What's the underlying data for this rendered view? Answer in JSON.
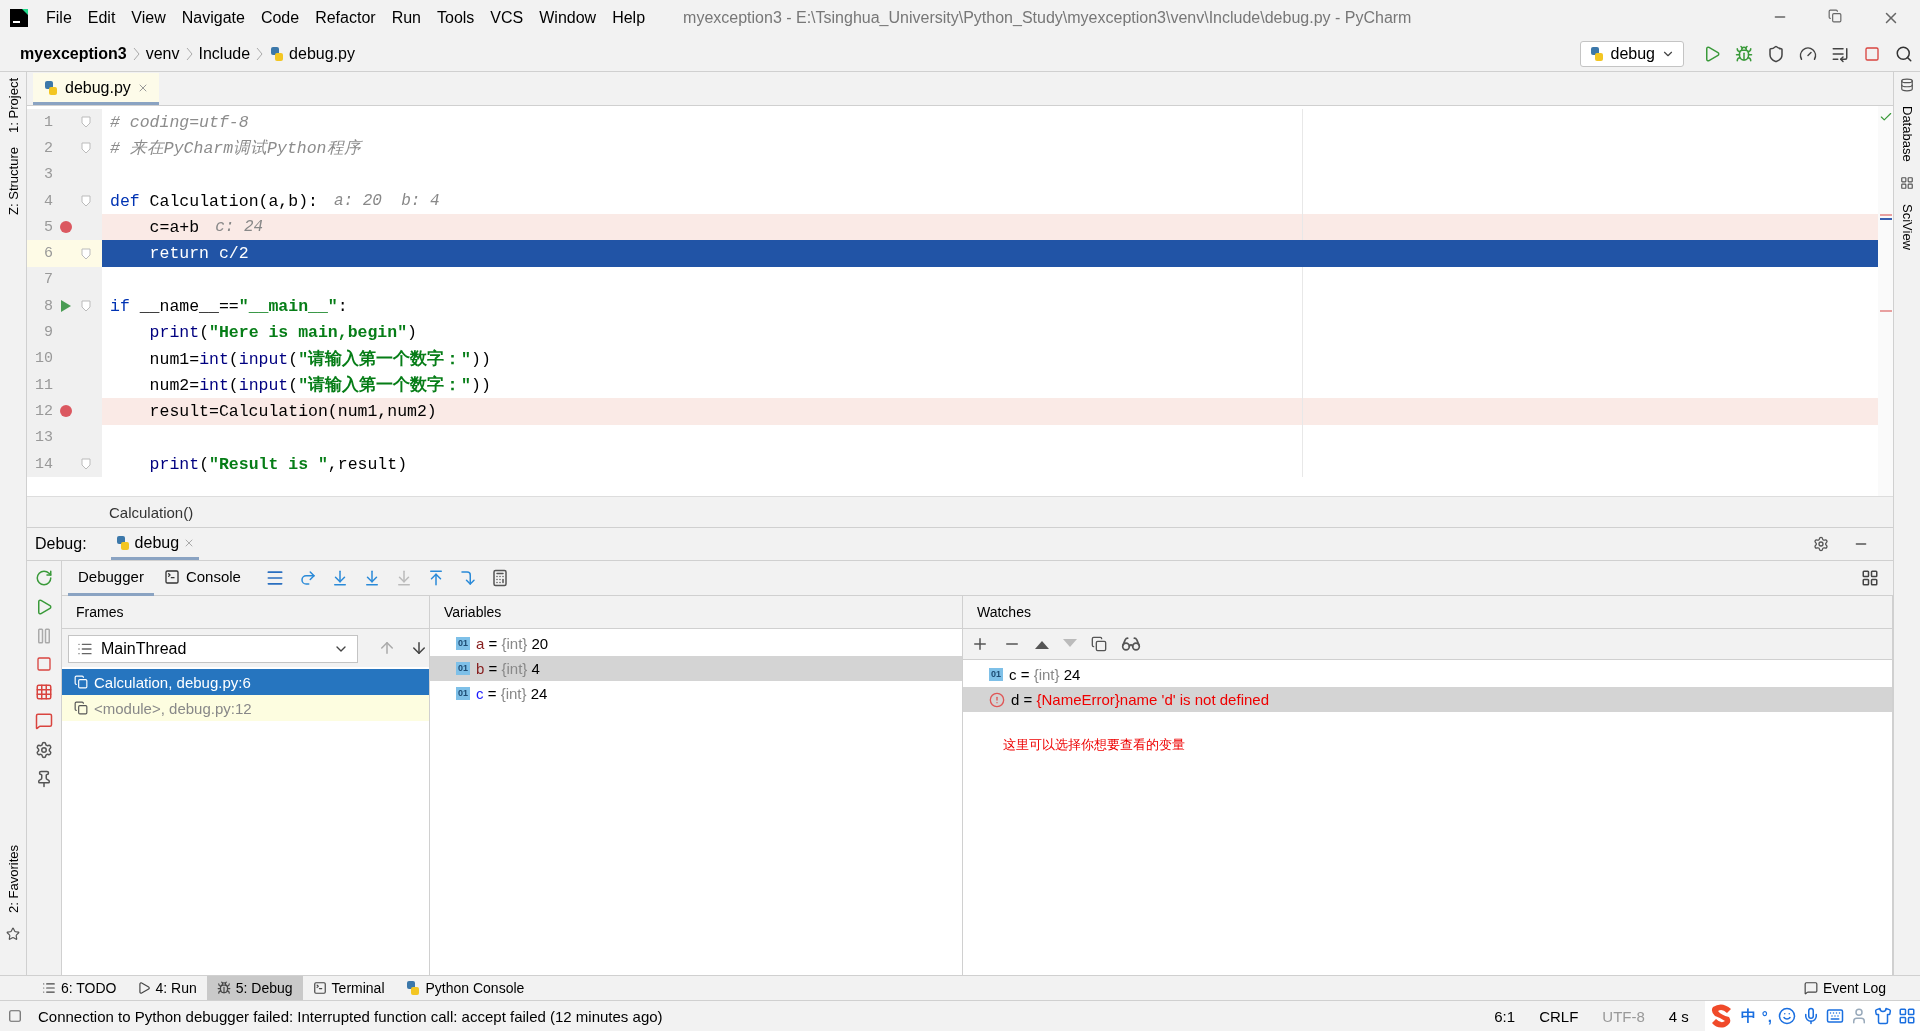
{
  "window": {
    "title": "myexception3 - E:\\Tsinghua_University\\Python_Study\\myexception3\\venv\\Include\\debug.py - PyCharm"
  },
  "menu": [
    "File",
    "Edit",
    "View",
    "Navigate",
    "Code",
    "Refactor",
    "Run",
    "Tools",
    "VCS",
    "Window",
    "Help"
  ],
  "breadcrumbs": [
    {
      "label": "myexception3",
      "kind": "project"
    },
    {
      "label": "venv",
      "kind": "folder"
    },
    {
      "label": "Include",
      "kind": "folder"
    },
    {
      "label": "debug.py",
      "kind": "file"
    }
  ],
  "run_config": {
    "label": "debug"
  },
  "left_strip": {
    "top": [
      "1: Project",
      "Z: Structure"
    ],
    "bottom": [
      "2: Favorites"
    ]
  },
  "right_strip": [
    "Database",
    "SciView"
  ],
  "editor_tabs": [
    {
      "label": "debug.py",
      "selected": true
    }
  ],
  "code": [
    {
      "number": "1",
      "tokens": [
        {
          "kind": "comment",
          "t": "# coding=utf-8"
        }
      ],
      "breakpoint": false,
      "current": false,
      "run_marker": false,
      "fold": true
    },
    {
      "number": "2",
      "tokens": [
        {
          "kind": "comment",
          "t": "# 来在PyCharm调试Python程序"
        }
      ],
      "breakpoint": false,
      "current": false,
      "run_marker": false,
      "fold": true
    },
    {
      "number": "3",
      "breakpoint": false,
      "current": false,
      "run_marker": false,
      "fold": false
    },
    {
      "number": "4",
      "tokens": [
        {
          "kind": "kw",
          "t": "def"
        },
        {
          "kind": "plain",
          "t": " Calculation(a,b):"
        }
      ],
      "hint": "a: 20  b: 4",
      "breakpoint": false,
      "current": false,
      "run_marker": false,
      "fold": true
    },
    {
      "number": "5",
      "tokens": [
        {
          "kind": "plain",
          "t": "    c=a+b"
        }
      ],
      "hint": "c: 24",
      "breakpoint": true,
      "current": false,
      "run_marker": false,
      "fold": false
    },
    {
      "number": "6",
      "tokens": [
        {
          "kind": "plain",
          "t": "    return c/2"
        }
      ],
      "breakpoint": false,
      "current": true,
      "run_marker": false,
      "fold": true
    },
    {
      "number": "7",
      "breakpoint": false,
      "current": false,
      "run_marker": false,
      "fold": false
    },
    {
      "number": "8",
      "tokens": [
        {
          "kind": "kw",
          "t": "if"
        },
        {
          "kind": "plain",
          "t": " __name__=="
        },
        {
          "kind": "str",
          "t": "\"__main__\""
        },
        {
          "kind": "plain",
          "t": ":"
        }
      ],
      "breakpoint": false,
      "current": false,
      "run_marker": true,
      "fold": true
    },
    {
      "number": "9",
      "tokens": [
        {
          "kind": "builtin",
          "t": "    print"
        },
        {
          "kind": "plain",
          "t": "("
        },
        {
          "kind": "str",
          "t": "\"Here is main,begin\""
        },
        {
          "kind": "plain",
          "t": ")"
        }
      ],
      "breakpoint": false,
      "current": false,
      "run_marker": false,
      "fold": false
    },
    {
      "number": "10",
      "tokens": [
        {
          "kind": "plain",
          "t": "    num1="
        },
        {
          "kind": "builtin",
          "t": "int"
        },
        {
          "kind": "plain",
          "t": "("
        },
        {
          "kind": "builtin",
          "t": "input"
        },
        {
          "kind": "plain",
          "t": "("
        },
        {
          "kind": "str",
          "t": "\"请输入第一个数字：\""
        },
        {
          "kind": "plain",
          "t": "))"
        }
      ],
      "breakpoint": false,
      "current": false,
      "run_marker": false,
      "fold": false
    },
    {
      "number": "11",
      "tokens": [
        {
          "kind": "plain",
          "t": "    num2="
        },
        {
          "kind": "builtin",
          "t": "int"
        },
        {
          "kind": "plain",
          "t": "("
        },
        {
          "kind": "builtin",
          "t": "input"
        },
        {
          "kind": "plain",
          "t": "("
        },
        {
          "kind": "str",
          "t": "\"请输入第一个数字：\""
        },
        {
          "kind": "plain",
          "t": "))"
        }
      ],
      "breakpoint": false,
      "current": false,
      "run_marker": false,
      "fold": false
    },
    {
      "number": "12",
      "tokens": [
        {
          "kind": "plain",
          "t": "    result=Calculation(num1,num2)"
        }
      ],
      "breakpoint": true,
      "current": false,
      "run_marker": false,
      "fold": false
    },
    {
      "number": "13",
      "breakpoint": false,
      "current": false,
      "run_marker": false,
      "fold": false
    },
    {
      "number": "14",
      "tokens": [
        {
          "kind": "builtin",
          "t": "    print"
        },
        {
          "kind": "plain",
          "t": "("
        },
        {
          "kind": "str",
          "t": "\"Result is \""
        },
        {
          "kind": "plain",
          "t": ",result)"
        }
      ],
      "breakpoint": false,
      "current": false,
      "run_marker": false,
      "fold": true
    }
  ],
  "code_breadcrumb": "Calculation()",
  "debug": {
    "label": "Debug:",
    "session_tab": {
      "label": "debug",
      "selected": true
    },
    "tabs": [
      {
        "label": "Debugger",
        "selected": true,
        "kind": "debugger"
      },
      {
        "label": "Console",
        "selected": false,
        "kind": "console"
      }
    ],
    "frames": {
      "header": "Frames",
      "thread": "MainThread",
      "items": [
        {
          "label": "Calculation, debug.py:6",
          "selected": true
        },
        {
          "label": "<module>, debug.py:12",
          "selected": false
        }
      ]
    },
    "variables": {
      "header": "Variables",
      "items": [
        {
          "icon_label": "01",
          "name": "a",
          "color": "#871e1e",
          "equals": "=",
          "type": "{int}",
          "value": "20",
          "selected": false
        },
        {
          "icon_label": "01",
          "name": "b",
          "color": "#871e1e",
          "equals": "=",
          "type": "{int}",
          "value": "4",
          "selected": true
        },
        {
          "icon_label": "01",
          "name": "c",
          "color": "#1a1aff",
          "equals": "=",
          "type": "{int}",
          "value": "24",
          "selected": false
        }
      ]
    },
    "watches": {
      "header": "Watches",
      "items": [
        {
          "kind": "value",
          "icon_label": "01",
          "name": "c",
          "equals": "=",
          "type": "{int}",
          "value": "24",
          "selected": false
        },
        {
          "kind": "error",
          "name": "d",
          "equals": "=",
          "type": "{NameError}",
          "value": "name 'd' is not defined",
          "selected": true
        }
      ],
      "note": "这里可以选择你想要查看的变量"
    }
  },
  "tool_windows": [
    {
      "label": "6: TODO",
      "kind": "list",
      "selected": false
    },
    {
      "label": "4: Run",
      "kind": "run",
      "selected": false
    },
    {
      "label": "5: Debug",
      "kind": "debug",
      "selected": true
    },
    {
      "label": "Terminal",
      "kind": "terminal",
      "selected": false
    },
    {
      "label": "Python Console",
      "kind": "python",
      "selected": false
    }
  ],
  "event_log": "Event Log",
  "status_bar": {
    "message": "Connection to Python debugger failed: Interrupted function call: accept failed (12 minutes ago)",
    "position": "6:1",
    "line_separator": "CRLF",
    "encoding": "UTF-8",
    "indent": "4 s",
    "ime_mode": "中",
    "ime_punct": "°,"
  }
}
